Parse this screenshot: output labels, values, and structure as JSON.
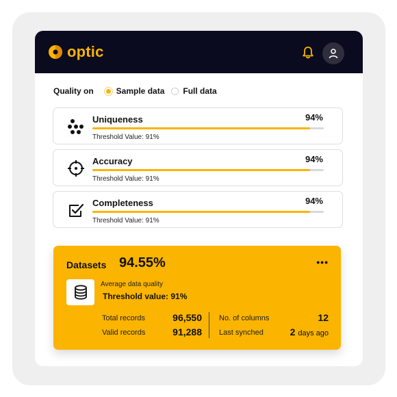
{
  "brand": {
    "name": "optic",
    "accent": "#fbb400",
    "dark": "#0b0b1f"
  },
  "header": {
    "bell_icon": "bell-icon",
    "avatar_icon": "user-icon"
  },
  "quality": {
    "label": "Quality on",
    "options": [
      {
        "label": "Sample data",
        "selected": true
      },
      {
        "label": "Full data",
        "selected": false
      }
    ]
  },
  "metrics": [
    {
      "name": "Uniqueness",
      "percent": "94%",
      "progress": 0.94,
      "threshold": "Threshold Value: 91%",
      "icon": "dots-icon"
    },
    {
      "name": "Accuracy",
      "percent": "94%",
      "progress": 0.94,
      "threshold": "Threshold Value: 91%",
      "icon": "crosshair-icon"
    },
    {
      "name": "Completeness",
      "percent": "94%",
      "progress": 0.94,
      "threshold": "Threshold Value: 91%",
      "icon": "checkbox-icon"
    }
  ],
  "datasets": {
    "title": "Datasets",
    "value": "94.55%",
    "more": "•••",
    "avg_label": "Average data quality",
    "threshold": "Threshold value: 91%",
    "total_records_label": "Total records",
    "total_records": "96,550",
    "valid_records_label": "Valid records",
    "valid_records": "91,288",
    "columns_label": "No. of columns",
    "columns": "12",
    "synched_label": "Last synched",
    "synched_num": "2",
    "synched_unit": "days ago"
  }
}
